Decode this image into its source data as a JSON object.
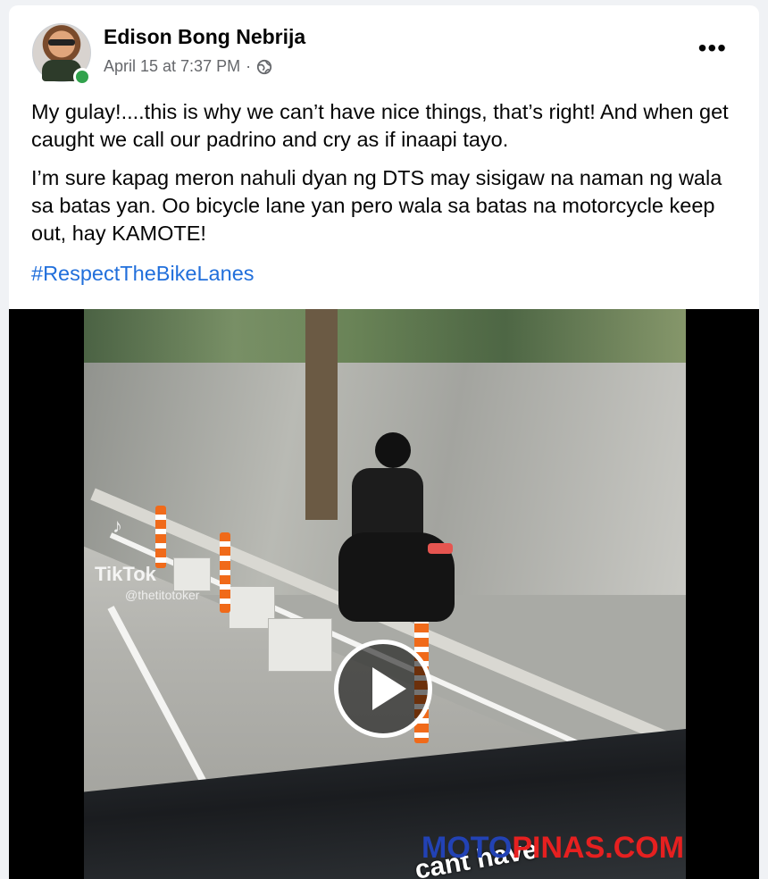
{
  "post": {
    "author": "Edison Bong Nebrija",
    "timestamp": "April 15 at 7:37 PM",
    "separator": "·",
    "privacy_icon": "globe-icon",
    "more_label": "•••",
    "paragraphs": [
      "My gulay!....this is why we can’t have nice things, that’s right! And when get caught we call our padrino and cry as if inaapi tayo.",
      "I’m sure kapag meron nahuli dyan ng DTS may sisigaw na naman ng wala sa batas yan. Oo bicycle lane yan pero wala sa batas na motorcycle keep out, hay KAMOTE!"
    ],
    "hashtag": "#RespectTheBikeLanes"
  },
  "video": {
    "tiktok_text": "TikTok",
    "tiktok_handle": "@thetitotoker",
    "caption": "cant have",
    "play_icon": "play-icon"
  },
  "watermark": {
    "part1": "MOTO",
    "part2": "PINAS.COM"
  },
  "colors": {
    "link": "#216fdb",
    "online": "#31a24c",
    "watermark_blue": "#2242b5",
    "watermark_red": "#e62020"
  }
}
